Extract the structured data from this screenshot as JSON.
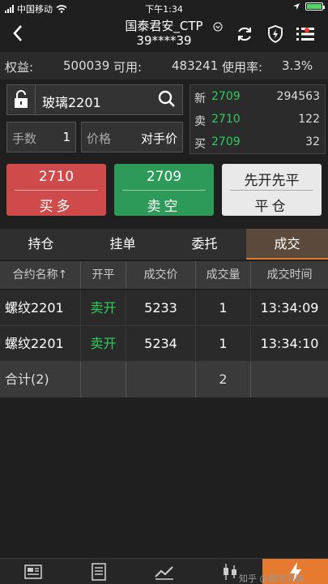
{
  "status_bar": {
    "carrier": "中国移动",
    "time": "下午1:34"
  },
  "header": {
    "title_line1": "国泰君安_CTP",
    "title_line2": "39****39"
  },
  "account": {
    "equity_label": "权益:",
    "equity_value": "500039",
    "available_label": "可用:",
    "available_value": "483241",
    "usage_label": "使用率:",
    "usage_value": "3.3%"
  },
  "order": {
    "instrument": "玻璃2201",
    "qty_label": "手数",
    "qty_value": "1",
    "price_label": "价格",
    "price_value": "对手价"
  },
  "quotes": [
    {
      "label": "新",
      "price": "2709",
      "volume": "294563"
    },
    {
      "label": "卖",
      "price": "2710",
      "volume": "122"
    },
    {
      "label": "买",
      "price": "2709",
      "volume": "32"
    }
  ],
  "buttons": {
    "buy": {
      "price": "2710",
      "label": "买多"
    },
    "sell": {
      "price": "2709",
      "label": "卖空"
    },
    "close": {
      "mode": "先开先平",
      "label": "平仓"
    }
  },
  "tabs": [
    "持仓",
    "挂单",
    "委托",
    "成交"
  ],
  "table": {
    "headers": [
      "合约名称↑",
      "开平",
      "成交价",
      "成交量",
      "成交时间"
    ],
    "rows": [
      {
        "name": "螺纹2201",
        "open_close": "卖开",
        "price": "5233",
        "volume": "1",
        "time": "13:34:09"
      },
      {
        "name": "螺纹2201",
        "open_close": "卖开",
        "price": "5234",
        "volume": "1",
        "time": "13:34:10"
      }
    ],
    "total": {
      "label": "合计(2)",
      "volume": "2"
    }
  },
  "watermark": "知乎 @期货先锋",
  "colors": {
    "accent": "#e67a2e",
    "buy": "#cf4a4a",
    "sell": "#2e9a5a",
    "green_text": "#2ecc5b"
  }
}
